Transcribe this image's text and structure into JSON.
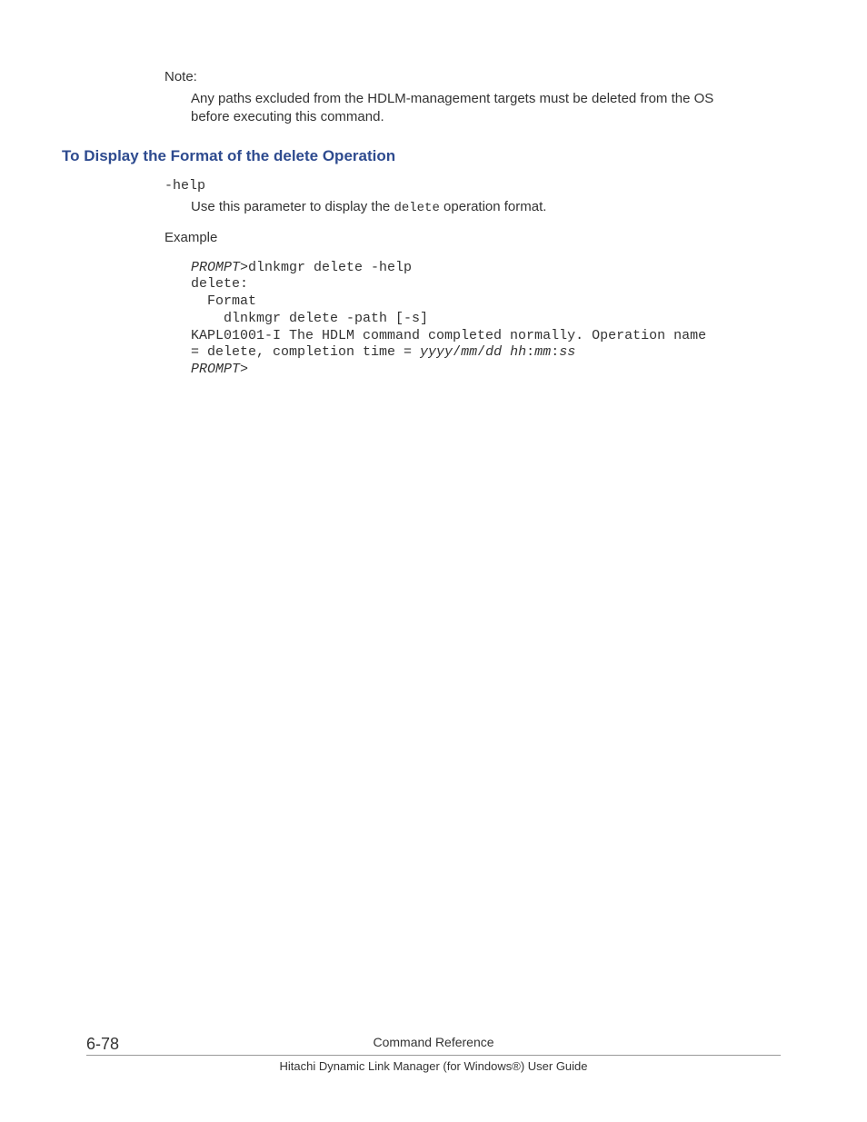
{
  "note": {
    "label": "Note:",
    "text": "Any paths excluded from the HDLM-management targets must be deleted from the OS before executing this command."
  },
  "section": {
    "heading": "To Display the Format of the delete Operation",
    "help_param": "-help",
    "help_desc_prefix": "Use this parameter to display the ",
    "help_desc_code": "delete",
    "help_desc_suffix": " operation format.",
    "example_label": "Example"
  },
  "code": {
    "prompt1": "PROMPT",
    "line1_suffix": ">dlnkmgr delete -help",
    "line2": "delete:",
    "line3": "  Format",
    "line4": "    dlnkmgr delete -path [-s]",
    "line5": "KAPL01001-I The HDLM command completed normally. Operation name",
    "line6_prefix": "= delete, completion time = ",
    "ts_yyyy": "yyyy",
    "ts_mm1": "mm",
    "ts_dd": "dd",
    "ts_hh": "hh",
    "ts_mm2": "mm",
    "ts_ss": "ss",
    "prompt2": "PROMPT",
    "line7_suffix": ">"
  },
  "footer": {
    "page_number": "6-78",
    "title": "Command Reference",
    "subtitle": "Hitachi Dynamic Link Manager (for Windows®) User Guide"
  }
}
